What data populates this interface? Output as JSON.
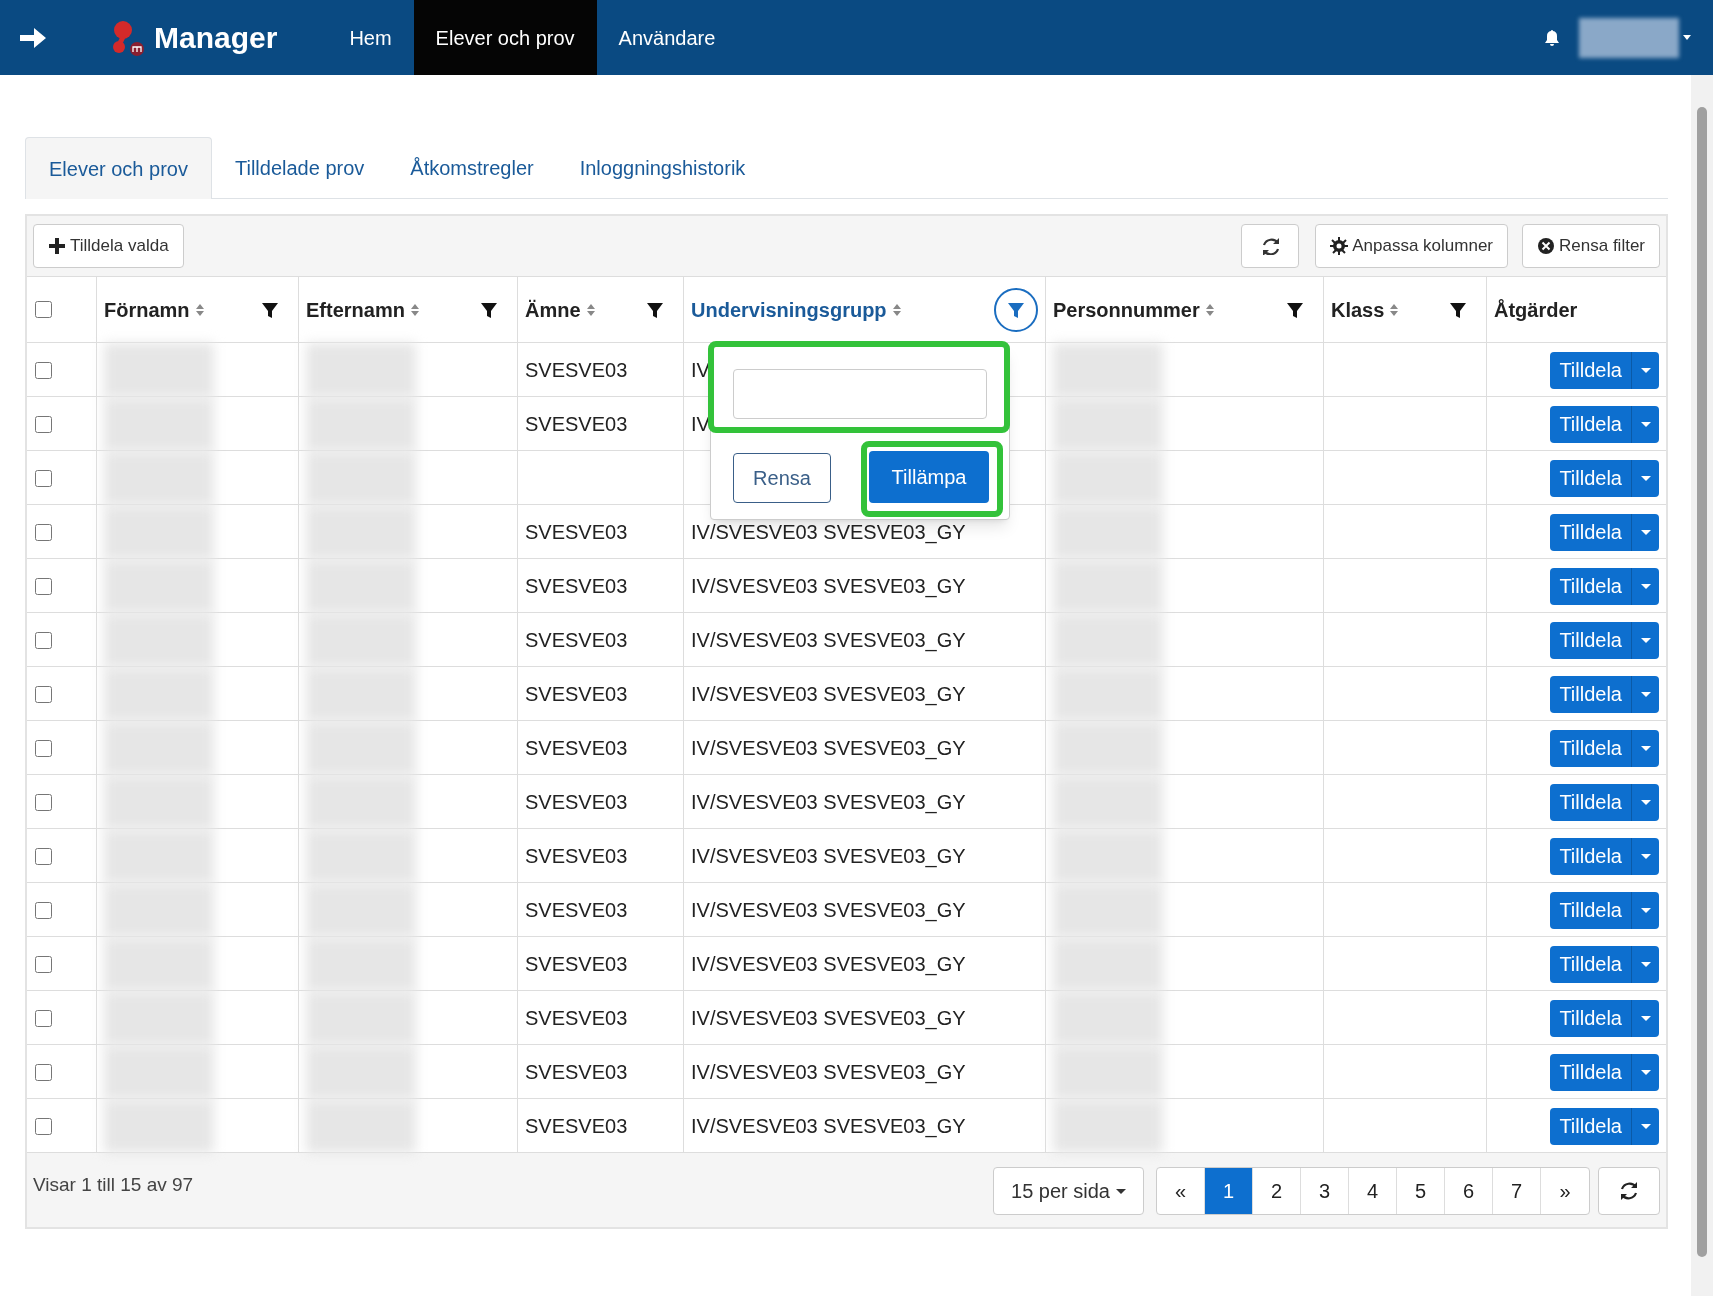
{
  "navbar": {
    "logo_text": "Manager",
    "items": [
      {
        "label": "Hem",
        "selected": false
      },
      {
        "label": "Elever och prov",
        "selected": true
      },
      {
        "label": "Användare",
        "selected": false
      }
    ]
  },
  "tabs": [
    {
      "label": "Elever och prov",
      "selected": true
    },
    {
      "label": "Tilldelade prov",
      "selected": false
    },
    {
      "label": "Åtkomstregler",
      "selected": false
    },
    {
      "label": "Inloggningshistorik",
      "selected": false
    }
  ],
  "toolbar": {
    "assign_button": "Tilldela valda",
    "columns_button": "Anpassa kolumner",
    "clear_filter_button": "Rensa filter"
  },
  "select_all_checked": false,
  "columns": [
    {
      "label": "Förnamn",
      "kind": "redacted",
      "sortable": true,
      "filter": true,
      "filter_active": false
    },
    {
      "label": "Efternamn",
      "kind": "redacted",
      "sortable": true,
      "filter": true,
      "filter_active": false
    },
    {
      "label": "Ämne",
      "kind": "subject",
      "sortable": true,
      "filter": true,
      "filter_active": false
    },
    {
      "label": "Undervisningsgrupp",
      "kind": "group",
      "sortable": true,
      "filter": true,
      "filter_active": true
    },
    {
      "label": "Personnummer",
      "kind": "redacted",
      "sortable": true,
      "filter": true,
      "filter_active": false
    },
    {
      "label": "Klass",
      "kind": "class",
      "sortable": true,
      "filter": true,
      "filter_active": false
    },
    {
      "label": "Åtgärder",
      "kind": "actions",
      "sortable": false,
      "filter": false,
      "filter_active": false
    }
  ],
  "rows": [
    {
      "checked": false,
      "subject": "SVESVE03",
      "group": "IV",
      "action": "Tilldela"
    },
    {
      "checked": false,
      "subject": "SVESVE03",
      "group": "IV",
      "action": "Tilldela"
    },
    {
      "checked": false,
      "action": "Tilldela"
    },
    {
      "checked": false,
      "subject": "SVESVE03",
      "group": "IV/SVESVE03 SVESVE03_GY",
      "action": "Tilldela"
    },
    {
      "checked": false,
      "subject": "SVESVE03",
      "group": "IV/SVESVE03 SVESVE03_GY",
      "action": "Tilldela"
    },
    {
      "checked": false,
      "subject": "SVESVE03",
      "group": "IV/SVESVE03 SVESVE03_GY",
      "action": "Tilldela"
    },
    {
      "checked": false,
      "subject": "SVESVE03",
      "group": "IV/SVESVE03 SVESVE03_GY",
      "action": "Tilldela"
    },
    {
      "checked": false,
      "subject": "SVESVE03",
      "group": "IV/SVESVE03 SVESVE03_GY",
      "action": "Tilldela"
    },
    {
      "checked": false,
      "subject": "SVESVE03",
      "group": "IV/SVESVE03 SVESVE03_GY",
      "action": "Tilldela"
    },
    {
      "checked": false,
      "subject": "SVESVE03",
      "group": "IV/SVESVE03 SVESVE03_GY",
      "action": "Tilldela"
    },
    {
      "checked": false,
      "subject": "SVESVE03",
      "group": "IV/SVESVE03 SVESVE03_GY",
      "action": "Tilldela"
    },
    {
      "checked": false,
      "subject": "SVESVE03",
      "group": "IV/SVESVE03 SVESVE03_GY",
      "action": "Tilldela"
    },
    {
      "checked": false,
      "subject": "SVESVE03",
      "group": "IV/SVESVE03 SVESVE03_GY",
      "action": "Tilldela"
    },
    {
      "checked": false,
      "subject": "SVESVE03",
      "group": "IV/SVESVE03 SVESVE03_GY",
      "action": "Tilldela"
    },
    {
      "checked": false,
      "subject": "SVESVE03",
      "group": "IV/SVESVE03 SVESVE03_GY",
      "action": "Tilldela"
    }
  ],
  "filter_popup": {
    "clear_button": "Rensa",
    "apply_button": "Tillämpa"
  },
  "footer": {
    "summary": "Visar 1 till 15 av 97",
    "per_page": "15 per sida",
    "prev": "«",
    "next": "»",
    "pages": [
      {
        "label": "1",
        "selected": true
      },
      {
        "label": "2",
        "selected": false
      },
      {
        "label": "3",
        "selected": false
      },
      {
        "label": "4",
        "selected": false
      },
      {
        "label": "5",
        "selected": false
      },
      {
        "label": "6",
        "selected": false
      },
      {
        "label": "7",
        "selected": false
      }
    ]
  }
}
